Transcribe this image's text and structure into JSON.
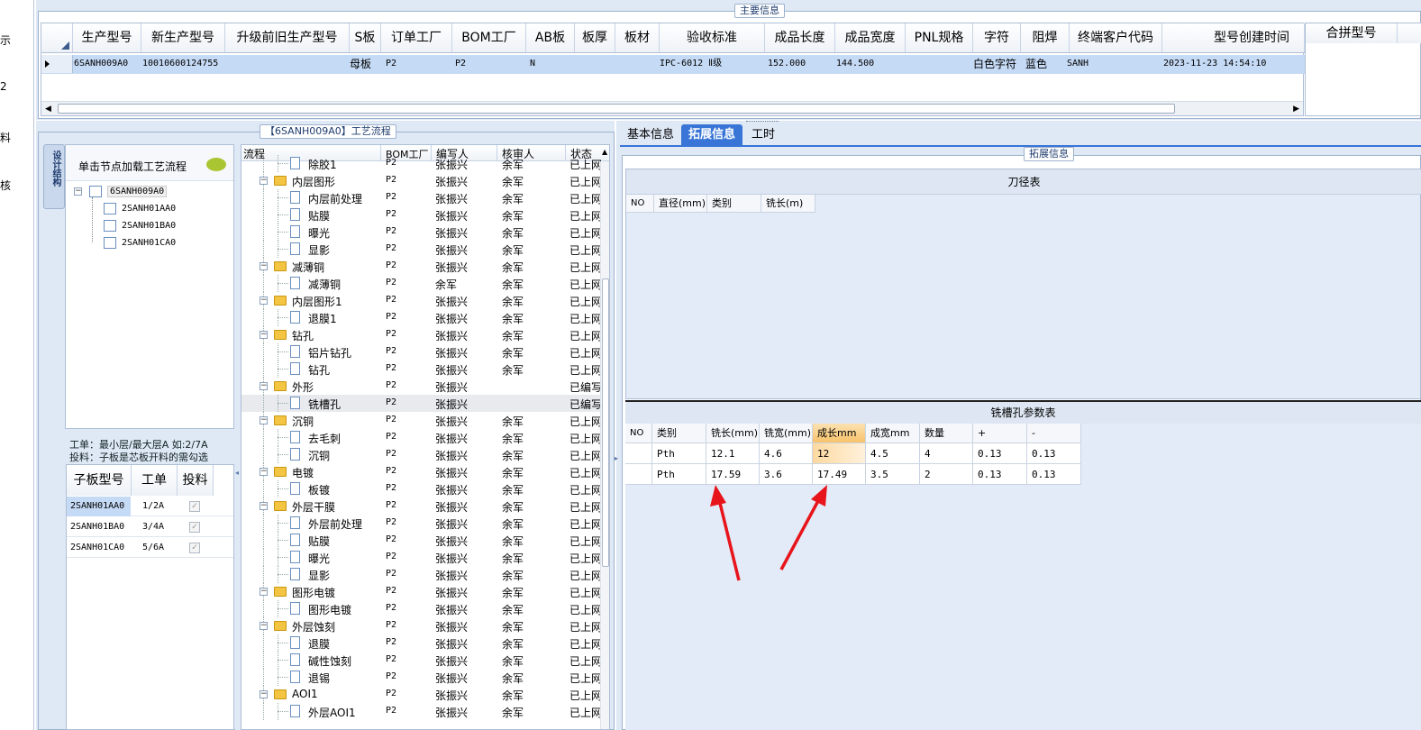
{
  "left_strip": [
    "示",
    "2",
    "料",
    "核"
  ],
  "main_info": {
    "title": "主要信息",
    "columns": [
      "生产型号",
      "新生产型号",
      "升级前旧生产型号",
      "S板",
      "订单工厂",
      "BOM工厂",
      "AB板",
      "板厚",
      "板材",
      "验收标准",
      "成品长度",
      "成品宽度",
      "PNL规格",
      "字符",
      "阻焊",
      "终端客户代码",
      "型号创建时间"
    ],
    "row": {
      "生产型号": "6SANH009A0",
      "新生产型号": "10010600124755",
      "升级前旧生产型号": "",
      "S板": "母板",
      "订单工厂": "P2",
      "BOM工厂": "P2",
      "AB板": "N",
      "板厚": "",
      "板材": "",
      "验收标准": "IPC-6012 Ⅱ级",
      "成品长度": "152.000",
      "成品宽度": "144.500",
      "PNL规格": "",
      "字符": "白色字符",
      "阻焊": "蓝色",
      "终端客户代码": "SANH",
      "型号创建时间": "2023-11-23 14:54:10"
    },
    "side_header": "合拼型号"
  },
  "process": {
    "title": "【6SANH009A0】工艺流程",
    "vertical_tab": "设计结构",
    "hint": "单击节点加载工艺流程",
    "tree": {
      "root": "6SANH009A0",
      "children": [
        "2SANH01AA0",
        "2SANH01BA0",
        "2SANH01CA0"
      ]
    },
    "note1": "工单：最小层/最大层A 如:2/7A",
    "note2": "投料：子板是芯板开料的需勾选",
    "sub_columns": [
      "子板型号",
      "工单",
      "投料"
    ],
    "sub_rows": [
      [
        "2SANH01AA0",
        "1/2A"
      ],
      [
        "2SANH01BA0",
        "3/4A"
      ],
      [
        "2SANH01CA0",
        "5/6A"
      ]
    ],
    "flow_columns": [
      "流程",
      "BOM工厂",
      "编写人",
      "核审人",
      "状态"
    ],
    "flow_rows": [
      {
        "name": "除胶1",
        "leaf": true,
        "f": "P2",
        "w": "张振兴",
        "r": "余军",
        "s": "已上网"
      },
      {
        "name": "内层图形",
        "leaf": false,
        "f": "P2",
        "w": "张振兴",
        "r": "余军",
        "s": "已上网"
      },
      {
        "name": "内层前处理",
        "leaf": true,
        "f": "P2",
        "w": "张振兴",
        "r": "余军",
        "s": "已上网"
      },
      {
        "name": "贴膜",
        "leaf": true,
        "f": "P2",
        "w": "张振兴",
        "r": "余军",
        "s": "已上网"
      },
      {
        "name": "曝光",
        "leaf": true,
        "f": "P2",
        "w": "张振兴",
        "r": "余军",
        "s": "已上网"
      },
      {
        "name": "显影",
        "leaf": true,
        "f": "P2",
        "w": "张振兴",
        "r": "余军",
        "s": "已上网"
      },
      {
        "name": "减薄铜",
        "leaf": false,
        "f": "P2",
        "w": "张振兴",
        "r": "余军",
        "s": "已上网"
      },
      {
        "name": "减薄铜",
        "leaf": true,
        "f": "P2",
        "w": "余军",
        "r": "余军",
        "s": "已上网"
      },
      {
        "name": "内层图形1",
        "leaf": false,
        "f": "P2",
        "w": "张振兴",
        "r": "余军",
        "s": "已上网"
      },
      {
        "name": "退膜1",
        "leaf": true,
        "f": "P2",
        "w": "张振兴",
        "r": "余军",
        "s": "已上网"
      },
      {
        "name": "钻孔",
        "leaf": false,
        "f": "P2",
        "w": "张振兴",
        "r": "余军",
        "s": "已上网"
      },
      {
        "name": "铝片钻孔",
        "leaf": true,
        "f": "P2",
        "w": "张振兴",
        "r": "余军",
        "s": "已上网"
      },
      {
        "name": "钻孔",
        "leaf": true,
        "f": "P2",
        "w": "张振兴",
        "r": "余军",
        "s": "已上网"
      },
      {
        "name": "外形",
        "leaf": false,
        "f": "P2",
        "w": "张振兴",
        "r": "",
        "s": "已编写"
      },
      {
        "name": "铣槽孔",
        "leaf": true,
        "f": "P2",
        "w": "张振兴",
        "r": "",
        "s": "已编写"
      },
      {
        "name": "沉铜",
        "leaf": false,
        "f": "P2",
        "w": "张振兴",
        "r": "余军",
        "s": "已上网"
      },
      {
        "name": "去毛刺",
        "leaf": true,
        "f": "P2",
        "w": "张振兴",
        "r": "余军",
        "s": "已上网"
      },
      {
        "name": "沉铜",
        "leaf": true,
        "f": "P2",
        "w": "张振兴",
        "r": "余军",
        "s": "已上网"
      },
      {
        "name": "电镀",
        "leaf": false,
        "f": "P2",
        "w": "张振兴",
        "r": "余军",
        "s": "已上网"
      },
      {
        "name": "板镀",
        "leaf": true,
        "f": "P2",
        "w": "张振兴",
        "r": "余军",
        "s": "已上网"
      },
      {
        "name": "外层干膜",
        "leaf": false,
        "f": "P2",
        "w": "张振兴",
        "r": "余军",
        "s": "已上网"
      },
      {
        "name": "外层前处理",
        "leaf": true,
        "f": "P2",
        "w": "张振兴",
        "r": "余军",
        "s": "已上网"
      },
      {
        "name": "贴膜",
        "leaf": true,
        "f": "P2",
        "w": "张振兴",
        "r": "余军",
        "s": "已上网"
      },
      {
        "name": "曝光",
        "leaf": true,
        "f": "P2",
        "w": "张振兴",
        "r": "余军",
        "s": "已上网"
      },
      {
        "name": "显影",
        "leaf": true,
        "f": "P2",
        "w": "张振兴",
        "r": "余军",
        "s": "已上网"
      },
      {
        "name": "图形电镀",
        "leaf": false,
        "f": "P2",
        "w": "张振兴",
        "r": "余军",
        "s": "已上网"
      },
      {
        "name": "图形电镀",
        "leaf": true,
        "f": "P2",
        "w": "张振兴",
        "r": "余军",
        "s": "已上网"
      },
      {
        "name": "外层蚀刻",
        "leaf": false,
        "f": "P2",
        "w": "张振兴",
        "r": "余军",
        "s": "已上网"
      },
      {
        "name": "退膜",
        "leaf": true,
        "f": "P2",
        "w": "张振兴",
        "r": "余军",
        "s": "已上网"
      },
      {
        "name": "碱性蚀刻",
        "leaf": true,
        "f": "P2",
        "w": "张振兴",
        "r": "余军",
        "s": "已上网"
      },
      {
        "name": "退锡",
        "leaf": true,
        "f": "P2",
        "w": "张振兴",
        "r": "余军",
        "s": "已上网"
      },
      {
        "name": "AOI1",
        "leaf": false,
        "f": "P2",
        "w": "张振兴",
        "r": "余军",
        "s": "已上网"
      },
      {
        "name": "外层AOI1",
        "leaf": true,
        "f": "P2",
        "w": "张振兴",
        "r": "余军",
        "s": "已上网"
      }
    ]
  },
  "right": {
    "tabs": [
      "基本信息",
      "拓展信息",
      "工时"
    ],
    "group_title": "拓展信息",
    "knife_title": "刀径表",
    "knife_columns": [
      "NO",
      "直径(mm)",
      "类别",
      "铣长(m)"
    ],
    "slot_title": "铣槽孔参数表",
    "slot_columns": [
      "NO",
      "类别",
      "铣长(mm)",
      "铣宽(mm)",
      "成长mm",
      "成宽mm",
      "数量",
      "+",
      "-"
    ],
    "slot_rows": [
      [
        "",
        "Pth",
        "12.1",
        "4.6",
        "12",
        "4.5",
        "4",
        "0.13",
        "0.13"
      ],
      [
        "",
        "Pth",
        "17.59",
        "3.6",
        "17.49",
        "3.5",
        "2",
        "0.13",
        "0.13"
      ]
    ]
  },
  "colors": {
    "accent": "#3875d7",
    "selected_row": "#c5daf5",
    "highlight": "#f8c26a",
    "arrow": "#e8141b"
  }
}
